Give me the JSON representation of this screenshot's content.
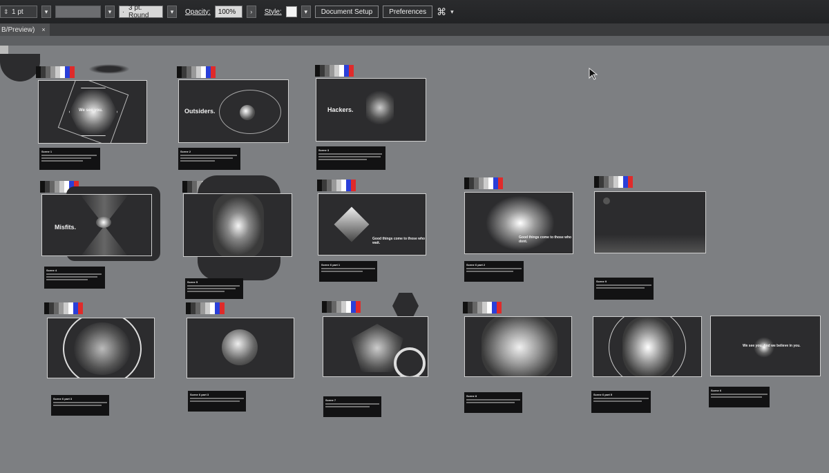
{
  "control_bar": {
    "stroke_weight": "1 pt",
    "brush_profile": "3 pt. Round",
    "opacity_label": "Opacity:",
    "opacity_value": "100%",
    "style_label": "Style:",
    "document_setup": "Document Setup",
    "preferences": "Preferences"
  },
  "document_tab": {
    "title": "B/Preview)",
    "close": "×"
  },
  "colors": {
    "canvas": "#7d7f82",
    "artboard": "#2c2c2e",
    "caption": "#121213",
    "swatch_strip": [
      "#111111",
      "#3a3a3a",
      "#666666",
      "#999999",
      "#cccccc",
      "#ffffff",
      "#2a3fd9",
      "#e02a2a"
    ]
  },
  "artboards": [
    {
      "name": "artboard-1",
      "text": "We see you."
    },
    {
      "name": "artboard-2",
      "text": "Outsiders."
    },
    {
      "name": "artboard-3",
      "text": "Hackers."
    },
    {
      "name": "artboard-4",
      "text": "Misfits."
    },
    {
      "name": "artboard-5",
      "text": ""
    },
    {
      "name": "artboard-6",
      "text": "Good things come to those who wait."
    },
    {
      "name": "artboard-7",
      "text": "Good things come to those who dont."
    },
    {
      "name": "artboard-8",
      "text": ""
    },
    {
      "name": "artboard-9",
      "text": ""
    },
    {
      "name": "artboard-10",
      "text": ""
    },
    {
      "name": "artboard-11",
      "text": ""
    },
    {
      "name": "artboard-12",
      "text": ""
    },
    {
      "name": "artboard-13",
      "text": ""
    },
    {
      "name": "artboard-14",
      "text": "We see you. And we believe in you."
    }
  ],
  "captions": [
    {
      "title": "Scene 1"
    },
    {
      "title": "Scene 2"
    },
    {
      "title": "Scene 3"
    },
    {
      "title": "Scene 4"
    },
    {
      "title": "Scene 5"
    },
    {
      "title": "Scene 6 part 1"
    },
    {
      "title": "Scene 6 part 2"
    },
    {
      "title": "Scene 9"
    },
    {
      "title": "Scene 6 part 3"
    },
    {
      "title": "Scene 6 part 3"
    },
    {
      "title": "Scene 7"
    },
    {
      "title": "Scene 8"
    },
    {
      "title": "Scene 6 part 5"
    },
    {
      "title": "Scene 6"
    }
  ]
}
